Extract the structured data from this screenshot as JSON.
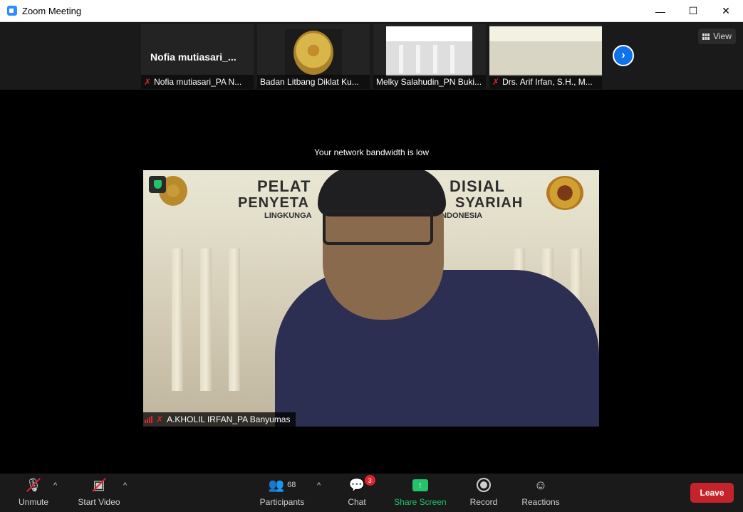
{
  "window": {
    "title": "Zoom Meeting",
    "controls": {
      "minimize": "—",
      "maximize": "☐",
      "close": "✕"
    }
  },
  "strip": {
    "thumbnails": [
      {
        "big_name": "Nofia  mutiasari_...",
        "label": "Nofia mutiasari_PA N...",
        "muted": true
      },
      {
        "label": "Badan Litbang Diklat Ku...",
        "muted": false
      },
      {
        "label": "Melky Salahudin_PN Buki...",
        "muted": false
      },
      {
        "label": "Drs. Arif Irfan, S.H., M...",
        "muted": true
      }
    ],
    "next_icon": "chevron-right-icon",
    "view_label": "View"
  },
  "main": {
    "bandwidth_notice": "Your network bandwidth is low",
    "active_speaker": {
      "name": "A.KHOLIL IRFAN_PA Banyumas",
      "muted": true
    },
    "background_text": {
      "line1": "PELAT",
      "line1b": "DISIAL",
      "line2": "PENYETA",
      "line2b": "SYARIAH",
      "line3": "LINGKUNGA",
      "line3b": "INDONESIA"
    }
  },
  "toolbar": {
    "unmute_label": "Unmute",
    "start_video_label": "Start Video",
    "participants_label": "Participants",
    "participants_count": "68",
    "chat_label": "Chat",
    "chat_badge": "3",
    "share_label": "Share Screen",
    "record_label": "Record",
    "reactions_label": "Reactions",
    "leave_label": "Leave",
    "caret": "^"
  },
  "colors": {
    "accent": "#0e72ed",
    "share": "#23c26b",
    "leave": "#c5232b",
    "muted": "#e0242d"
  }
}
